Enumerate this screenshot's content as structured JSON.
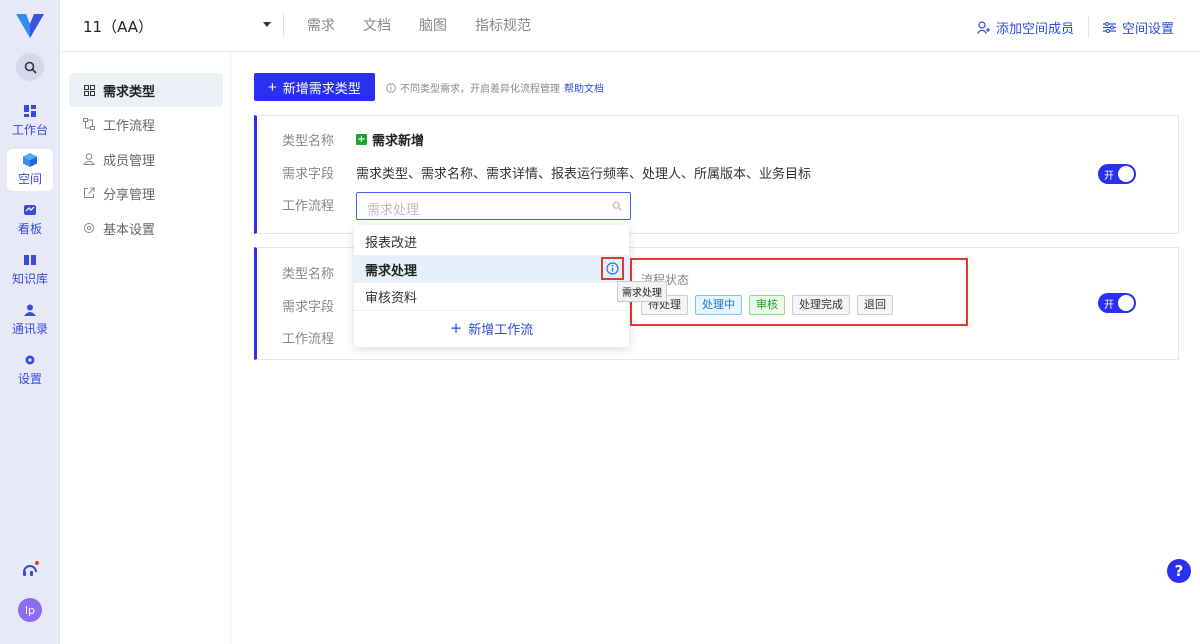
{
  "rail": {
    "items": [
      {
        "label": "工作台",
        "icon": "dashboard-icon"
      },
      {
        "label": "空间",
        "icon": "cube-icon"
      },
      {
        "label": "看板",
        "icon": "board-icon"
      },
      {
        "label": "知识库",
        "icon": "book-icon"
      },
      {
        "label": "通讯录",
        "icon": "contacts-icon"
      },
      {
        "label": "设置",
        "icon": "gear-icon"
      }
    ],
    "avatar": "lp"
  },
  "topbar": {
    "space_name": "11（AA）",
    "tabs": [
      "需求",
      "文档",
      "脑图",
      "指标规范"
    ],
    "add_member": "添加空间成员",
    "space_settings": "空间设置"
  },
  "subnav": {
    "items": [
      "需求类型",
      "工作流程",
      "成员管理",
      "分享管理",
      "基本设置"
    ]
  },
  "main": {
    "add_type_button": "新增需求类型",
    "hint": "不同类型需求，开启差异化流程管理",
    "help_link": "帮助文档",
    "labels": {
      "type_name": "类型名称",
      "fields": "需求字段",
      "workflow": "工作流程"
    },
    "card1": {
      "type_name": "需求新增",
      "fields": "需求类型、需求名称、需求详情、报表运行频率、处理人、所属版本、业务目标",
      "workflow_placeholder": "需求处理",
      "toggle": "开"
    },
    "card2": {
      "toggle": "开"
    },
    "dropdown": {
      "items": [
        "报表改进",
        "需求处理",
        "审核资料"
      ],
      "add_label": "新增工作流"
    },
    "tooltip": "需求处理",
    "status_panel": {
      "title": "流程状态",
      "tags": [
        "待处理",
        "处理中",
        "审核",
        "处理完成",
        "退回"
      ]
    },
    "help_button": "?"
  },
  "colors": {
    "accent": "#2b2ff0",
    "highlight_red": "#e23b2e",
    "green": "#1aa52b"
  }
}
